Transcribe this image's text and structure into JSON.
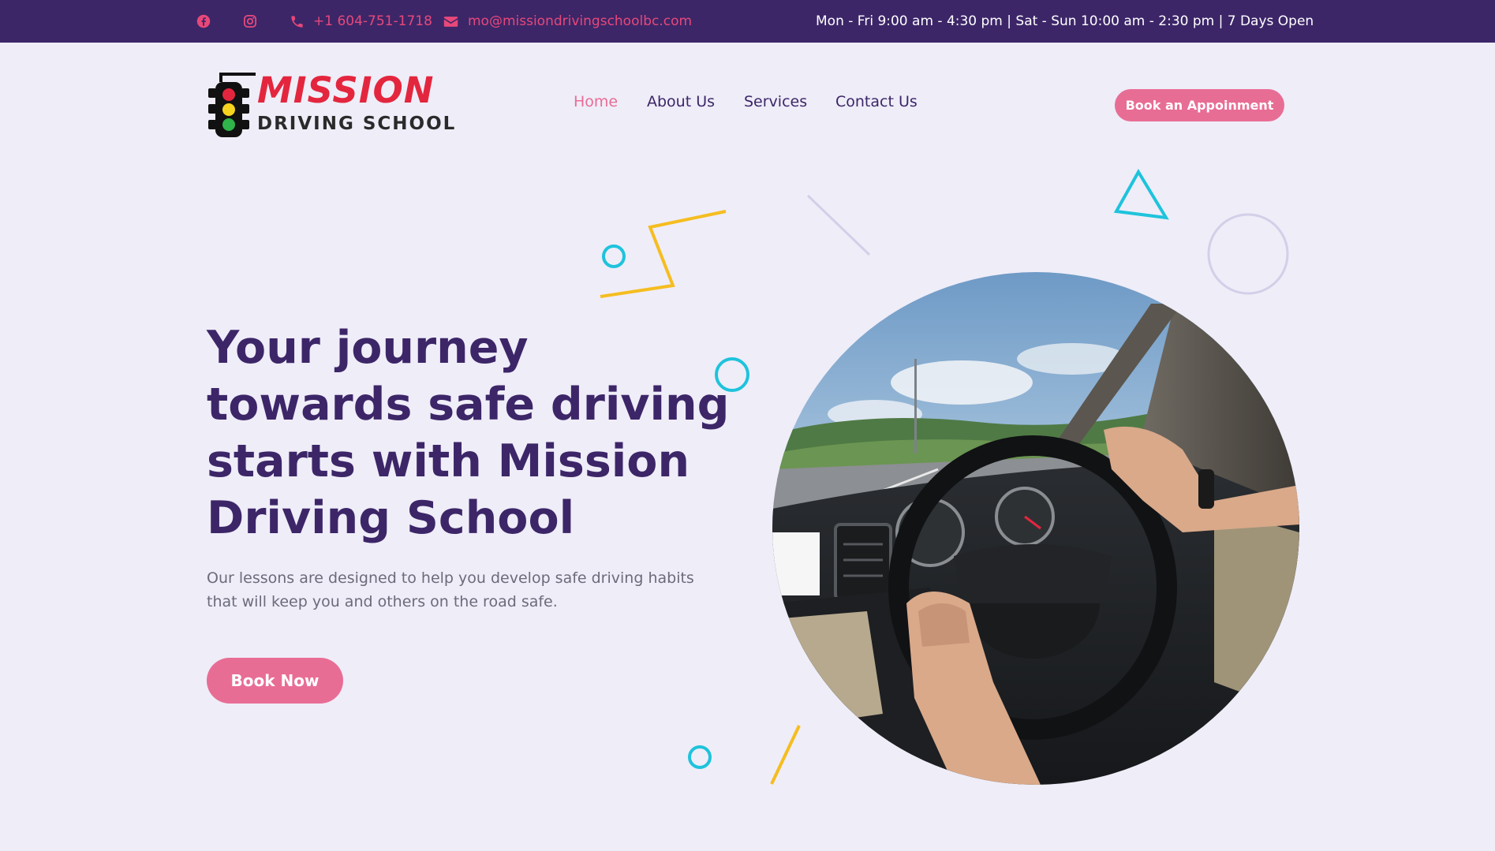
{
  "topbar": {
    "facebook_icon": "facebook-icon",
    "instagram_icon": "instagram-icon",
    "phone_icon": "phone-icon",
    "phone": "+1 604-751-1718",
    "email_icon": "envelope-icon",
    "email": "mo@missiondrivingschoolbc.com",
    "hours": "Mon - Fri 9:00 am - 4:30 pm | Sat - Sun 10:00 am - 2:30 pm | 7 Days Open"
  },
  "logo": {
    "line1": "MISSION",
    "line2": "DRIVING SCHOOL",
    "icon": "traffic-light-icon"
  },
  "nav": {
    "items": [
      {
        "label": "Home",
        "active": true
      },
      {
        "label": "About Us",
        "active": false
      },
      {
        "label": "Services",
        "active": false
      },
      {
        "label": "Contact Us",
        "active": false
      }
    ]
  },
  "header_cta": "Book an Appoinment",
  "hero": {
    "title": "Your journey towards safe driving starts with Mission Driving School",
    "subtitle": "Our lessons are designed to help you develop safe driving habits that will keep you and others on the road safe.",
    "button": "Book Now"
  },
  "colors": {
    "topbar": "#3c2668",
    "accent_pink": "#e86d95",
    "heading_purple": "#3c2668",
    "background": "#efedf8",
    "deco_cyan": "#1ec3dc",
    "deco_yellow": "#f5bd1f"
  }
}
